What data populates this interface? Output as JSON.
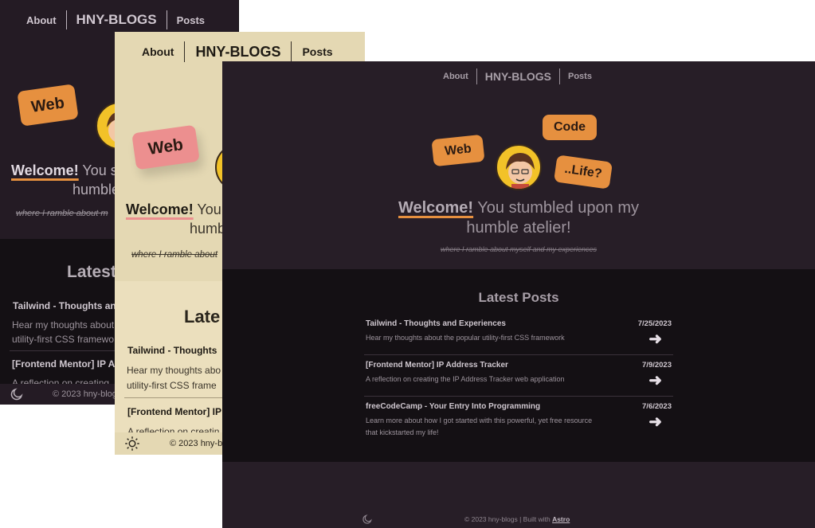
{
  "colors": {
    "dark_bg": "#271e27",
    "posts_bg": "#141014",
    "light_bg": "#e4d8b3",
    "accent_orange": "#e6903f",
    "accent_pink": "#ec8f8f"
  },
  "back_window": {
    "nav": {
      "about": "About",
      "brand": "HNY-BLOGS",
      "posts": "Posts"
    },
    "bubble_web": "Web",
    "welcome": "Welcome!",
    "rest_line1": " You s",
    "rest_line2": "humble",
    "tagline": "where I ramble about m",
    "latest_heading": "Latest",
    "post1_title": "Tailwind - Thoughts an",
    "post1_desc_1": "Hear my thoughts about",
    "post1_desc_2": "utility-first CSS framewo",
    "post2_title": "[Frontend Mentor] IP A",
    "post2_desc": "A reflection on creating",
    "footer_text": "© 2023 hny-blog",
    "theme_icon": "moon-icon"
  },
  "middle_window": {
    "nav": {
      "about": "About",
      "brand": "HNY-BLOGS",
      "posts": "Posts"
    },
    "bubble_web": "Web",
    "welcome": "Welcome!",
    "rest_line1": " You",
    "rest_line2": "humb",
    "tagline": "where I ramble about",
    "latest_heading": "Late",
    "post1_title": "Tailwind - Thoughts",
    "post1_desc_1": "Hear my thoughts abo",
    "post1_desc_2": "utility-first CSS frame",
    "post2_title": "[Frontend Mentor] IP",
    "post2_desc": "A reflection on creatin",
    "footer_text": "© 2023 hny-b",
    "theme_icon": "sun-icon"
  },
  "front_window": {
    "nav": {
      "about": "About",
      "brand": "HNY-BLOGS",
      "posts": "Posts"
    },
    "bubbles": {
      "web": "Web",
      "code": "Code",
      "life": "..Life?"
    },
    "welcome": "Welcome!",
    "rest_line1": " You stumbled upon my",
    "rest_line2": "humble atelier!",
    "tagline": "where I ramble about myself and my experiences",
    "latest_heading": "Latest Posts",
    "posts": [
      {
        "title": "Tailwind - Thoughts and Experiences",
        "desc": "Hear my thoughts about the popular utility-first CSS framework",
        "date": "7/25/2023",
        "arrow": "➜"
      },
      {
        "title": "[Frontend Mentor] IP Address Tracker",
        "desc": "A reflection on creating the IP Address Tracker web application",
        "date": "7/9/2023",
        "arrow": "➜"
      },
      {
        "title": "freeCodeCamp - Your Entry Into Programming",
        "desc": "Learn more about how I got started with this powerful, yet free resource that kickstarted my life!",
        "date": "7/6/2023",
        "arrow": "➜"
      }
    ],
    "footer_text": "© 2023 hny-blogs | Built with ",
    "footer_link": "Astro",
    "theme_icon": "moon-icon"
  }
}
